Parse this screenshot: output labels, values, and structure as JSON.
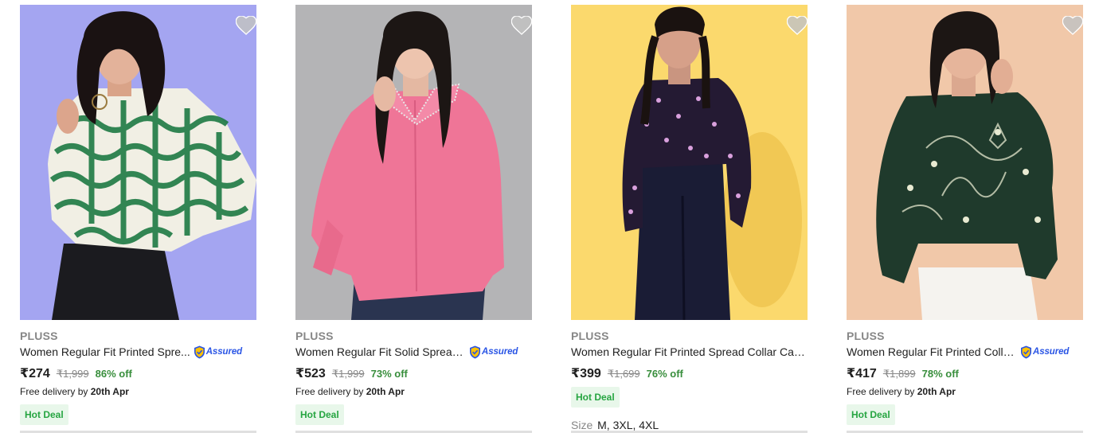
{
  "colors": {
    "brand_gray": "#878787",
    "title": "#212121",
    "discount_green": "#388e3c",
    "deal_bg": "#e8f7ea",
    "deal_text": "#26a541",
    "assured_blue": "#2a55e5",
    "wishlist_heart": "#c2c2c2"
  },
  "products": [
    {
      "brand": "PLUSS",
      "title": "Women Regular Fit Printed Spre...",
      "assured": "Assured",
      "price": "₹274",
      "mrp": "₹1,999",
      "discount": "86% off",
      "delivery_prefix": "Free delivery by",
      "delivery_date": "20th Apr",
      "deal": "Hot Deal",
      "icon": "heart-icon"
    },
    {
      "brand": "PLUSS",
      "title": "Women Regular Fit Solid Spread ...",
      "assured": "Assured",
      "price": "₹523",
      "mrp": "₹1,999",
      "discount": "73% off",
      "delivery_prefix": "Free delivery by",
      "delivery_date": "20th Apr",
      "deal": "Hot Deal",
      "icon": "heart-icon"
    },
    {
      "brand": "PLUSS",
      "title": "Women Regular Fit Printed Spread Collar Cas...",
      "price": "₹399",
      "mrp": "₹1,699",
      "discount": "76% off",
      "deal": "Hot Deal",
      "size_label": "Size",
      "sizes": "M, 3XL, 4XL",
      "icon": "heart-icon"
    },
    {
      "brand": "PLUSS",
      "title": "Women Regular Fit Printed Colla...",
      "assured": "Assured",
      "price": "₹417",
      "mrp": "₹1,899",
      "discount": "78% off",
      "delivery_prefix": "Free delivery by",
      "delivery_date": "20th Apr",
      "deal": "Hot Deal",
      "icon": "heart-icon"
    }
  ]
}
